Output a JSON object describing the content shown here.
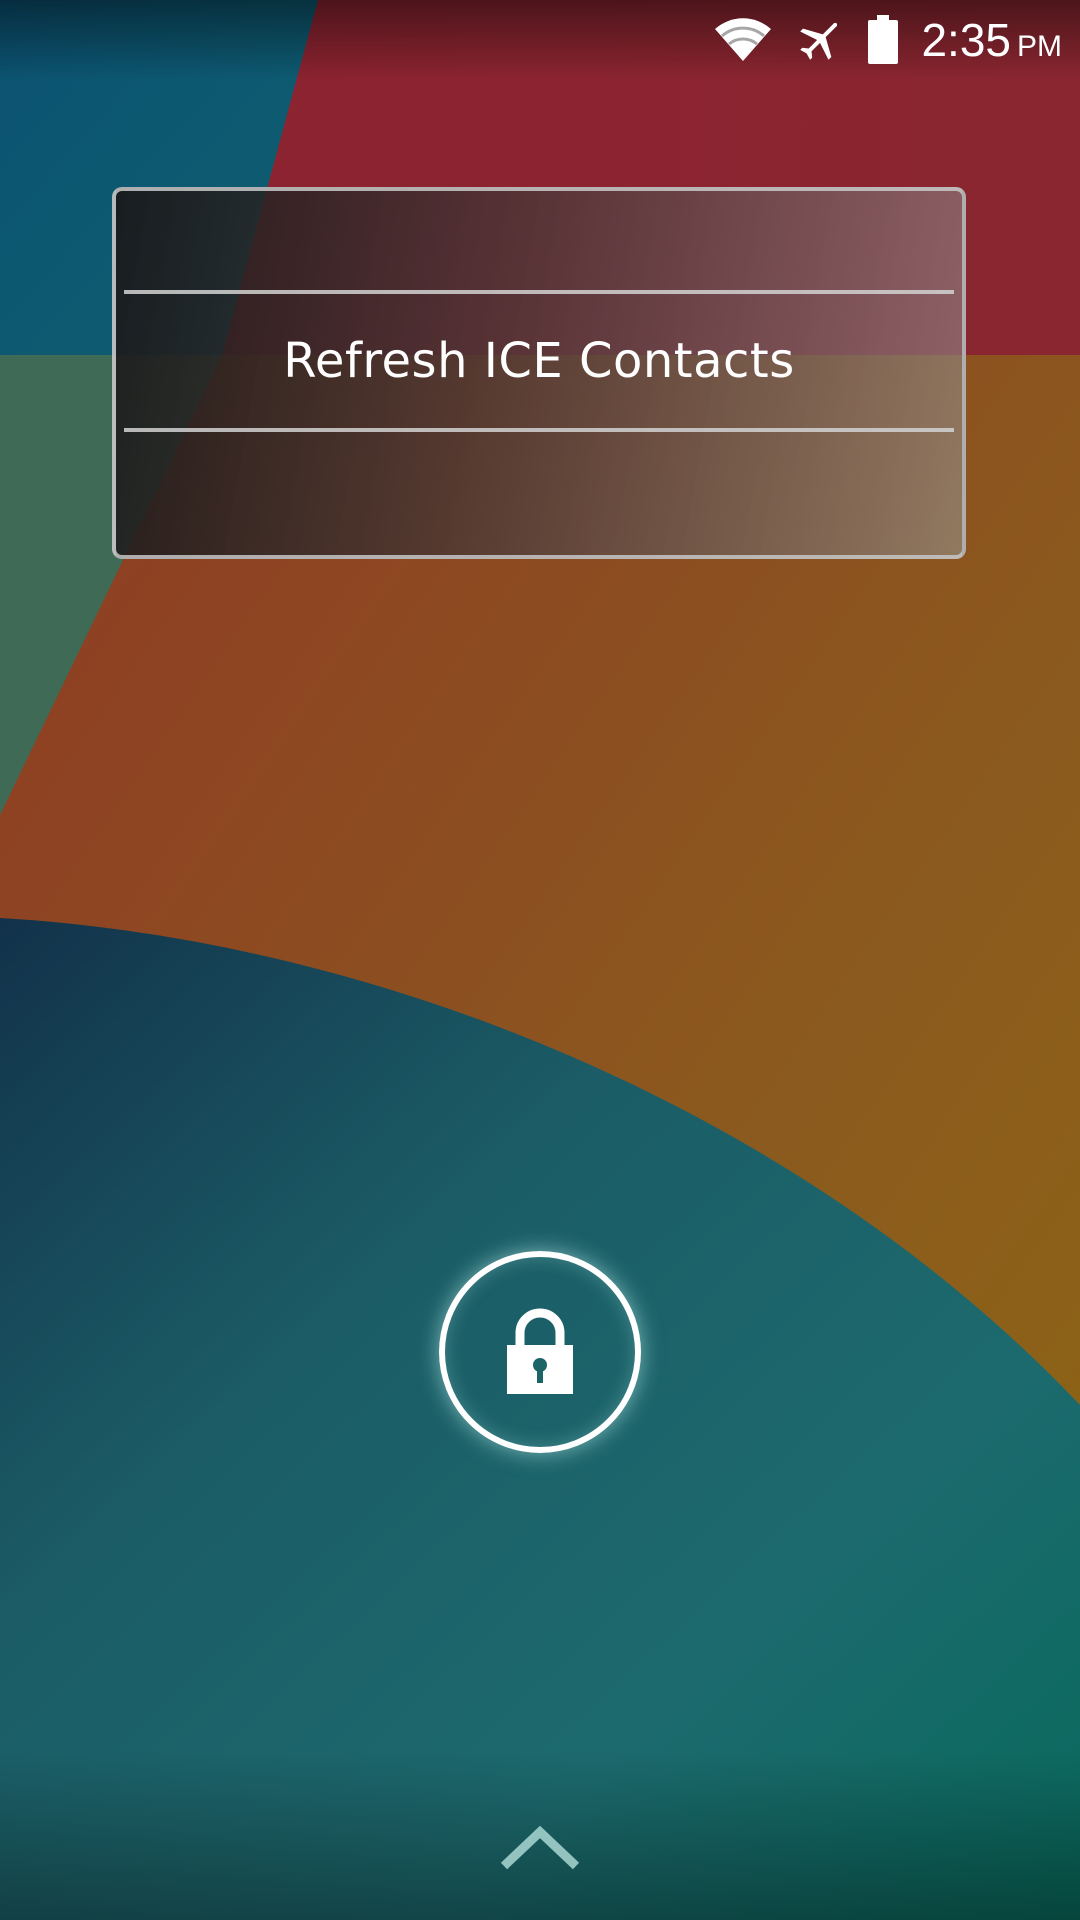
{
  "status_bar": {
    "icons": [
      "wifi-icon",
      "airplane-mode-icon",
      "battery-icon"
    ],
    "time": "2:35",
    "ampm": "PM"
  },
  "ice_widget": {
    "button_label": "Refresh ICE Contacts"
  },
  "lock": {
    "icon": "lock-icon"
  },
  "swipe": {
    "icon": "chevron-up-icon"
  },
  "colors": {
    "wallpaper_red": "#8e2330",
    "wallpaper_orange": "#8b4a22",
    "wallpaper_teal": "#1a6a6e",
    "wallpaper_blue": "#0b5c73",
    "wallpaper_green": "#3e6a52",
    "wallpaper_gold": "#8d6413"
  }
}
